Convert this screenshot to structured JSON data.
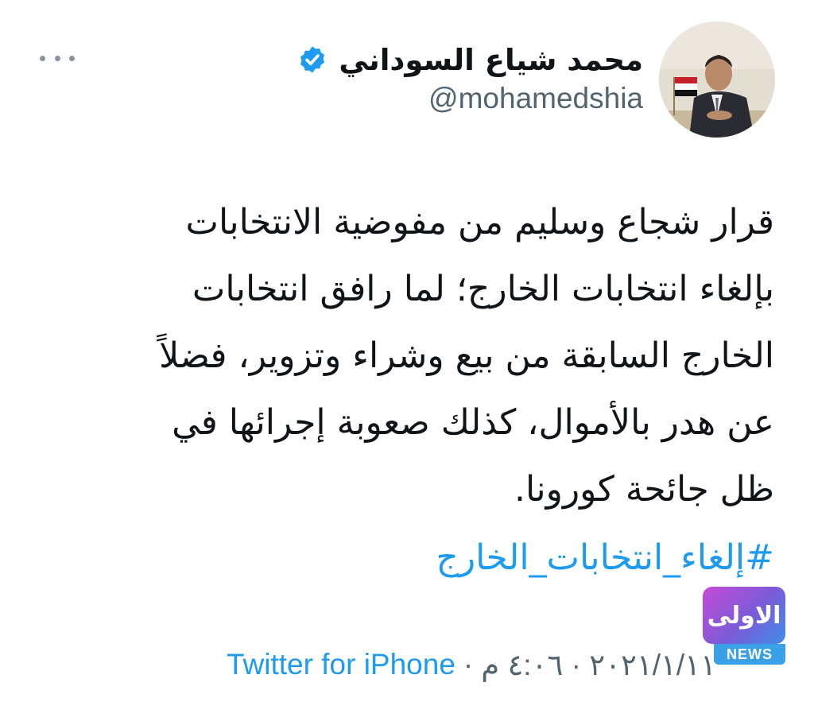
{
  "tweet": {
    "author": {
      "display_name": "محمد شياع السوداني",
      "handle": "@mohamedshia",
      "verified": true
    },
    "text_lines": [
      "قرار شجاع وسليم من مفوضية الانتخابات",
      "بإلغاء انتخابات الخارج؛ لما رافق انتخابات",
      "الخارج السابقة من بيع وشراء وتزوير، فضلاً",
      "عن هدر بالأموال، كذلك صعوبة إجرائها في",
      "ظل جائحة كورونا."
    ],
    "hashtag": "#إلغاء_انتخابات_الخارج",
    "timestamp": "٢٠٢١/١/١١ · ٤:٠٦ م",
    "source": "Twitter for iPhone"
  },
  "icons": {
    "more": "more-horizontal-icon",
    "verified": "verified-badge-icon"
  },
  "watermark": {
    "logo_text": "الاولى",
    "news_label": "NEWS"
  },
  "colors": {
    "link_blue": "#1d9bf0",
    "secondary_text": "#536471",
    "primary_text": "#0f1419"
  }
}
